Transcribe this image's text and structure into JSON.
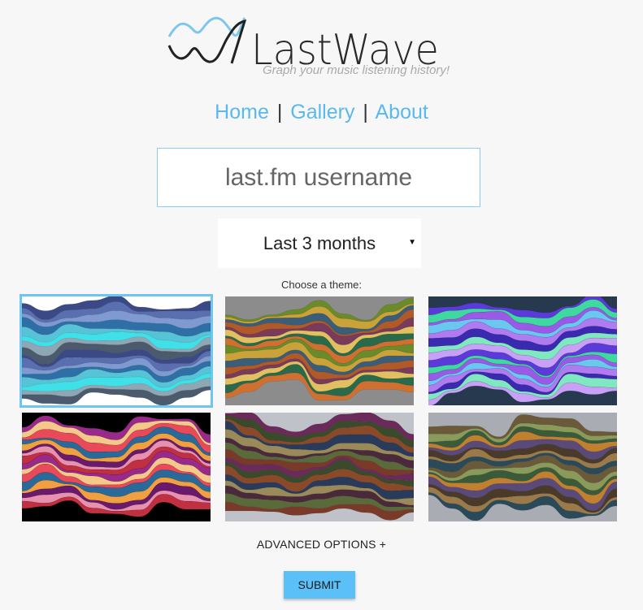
{
  "logo": {
    "title": "LastWave",
    "subtitle": "Graph your music listening history!",
    "icon": "wave-logo-icon"
  },
  "nav": {
    "home": "Home",
    "gallery": "Gallery",
    "about": "About",
    "separator": "|"
  },
  "username": {
    "placeholder": "last.fm username",
    "value": ""
  },
  "time_period": {
    "selected": "Last 3 months"
  },
  "themes": {
    "label": "Choose a theme:",
    "selected_index": 0,
    "items": [
      {
        "background": "#ffffff",
        "colors": [
          "#3b4a86",
          "#5a6fb0",
          "#7f9ad0",
          "#2e6fa5",
          "#56c3d6",
          "#3fe0e8",
          "#8fa6b5",
          "#4c5a6e"
        ]
      },
      {
        "background": "#8c8c8c",
        "colors": [
          "#6b8a2a",
          "#c9a23a",
          "#3a5e7a",
          "#b05a2a",
          "#7a3a5a",
          "#e0c060",
          "#2a6a4a",
          "#d07030"
        ]
      },
      {
        "background": "#26394f",
        "colors": [
          "#5a3ad8",
          "#3fd8a0",
          "#9b59e8",
          "#6ac8f0",
          "#b07af0",
          "#3a2ab0",
          "#80e8c0",
          "#c8a0f8"
        ]
      },
      {
        "background": "#000000",
        "colors": [
          "#9a2a8a",
          "#f4c88a",
          "#e84a5a",
          "#2a6a9a",
          "#f0a040",
          "#6a1a6a",
          "#e890b0",
          "#c03040"
        ]
      },
      {
        "background": "#bfc2c8",
        "colors": [
          "#6a2a5a",
          "#3a4a2a",
          "#8a4a2a",
          "#2a3a5a",
          "#9a8a5a",
          "#4a2a3a",
          "#5a6a3a",
          "#7a3a2a"
        ]
      },
      {
        "background": "#a9acb2",
        "colors": [
          "#6a5a3a",
          "#8a9a5a",
          "#3a5a3a",
          "#c08030",
          "#5a4a7a",
          "#4a3a2a",
          "#9a7a4a",
          "#2a4a5a"
        ]
      }
    ]
  },
  "advanced": {
    "label": "ADVANCED OPTIONS +"
  },
  "submit": {
    "label": "SUBMIT"
  }
}
